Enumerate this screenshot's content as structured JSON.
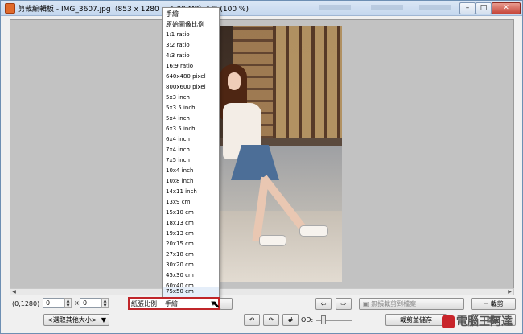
{
  "window": {
    "title": "剪裁編輯板 - IMG_3607.jpg（853 x 1280 = 1.09 MP）1/2 (100 %)",
    "min_label": "–",
    "max_label": "□",
    "close_label": "✕"
  },
  "dropdown": {
    "options": [
      "手繪",
      "原始圖像比例",
      "1:1 ratio",
      "3:2 ratio",
      "4:3 ratio",
      "16:9 ratio",
      "640x480 pixel",
      "800x600 pixel",
      "5x3 inch",
      "5x3.5 inch",
      "5x4 inch",
      "6x3.5 inch",
      "6x4 inch",
      "7x4 inch",
      "7x5 inch",
      "10x4 inch",
      "10x8 inch",
      "14x11 inch",
      "13x9 cm",
      "15x10 cm",
      "18x13 cm",
      "19x13 cm",
      "20x15 cm",
      "27x18 cm",
      "30x20 cm",
      "45x30 cm",
      "60x40 cm",
      "75x50 cm"
    ],
    "highlighted": "75x50 cm"
  },
  "controls": {
    "position_readout": "(0,1280)",
    "width_value": "0",
    "height_value": "0",
    "times_sign": "×",
    "size_select": "<選取其他大小>",
    "paper_ratio_label": "紙張比例",
    "paper_ratio_value": "手繪",
    "od_label": "OD:",
    "lossless_crop_button": "無損載剪到檔案",
    "crop_button": "載剪",
    "crop_save_button": "載剪並儲存",
    "close_button": "關閉",
    "sign_icon": "⊟"
  },
  "watermark": {
    "text": "電腦王阿達"
  },
  "colors": {
    "highlight_border": "#c0262a",
    "canvas_bg": "#c2c2c2",
    "title_gradient_top": "#dbe7f5"
  }
}
